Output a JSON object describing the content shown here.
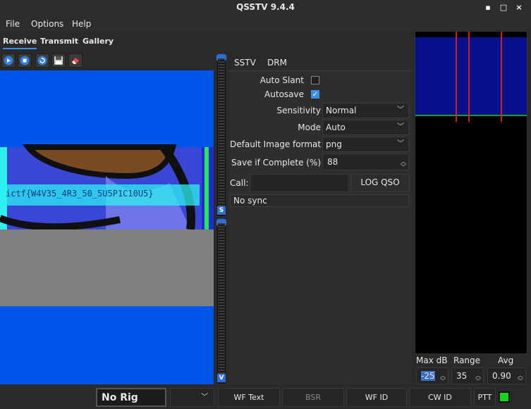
{
  "window": {
    "title": "QSSTV 9.4.4",
    "min": "▪",
    "max": "□",
    "close": "×"
  },
  "menu": {
    "file": "File",
    "options": "Options",
    "help": "Help"
  },
  "tabs": {
    "receive": "Receive",
    "transmit": "Transmit",
    "gallery": "Gallery"
  },
  "toolbar": {
    "icons": [
      "play-icon",
      "stop-icon",
      "refresh-icon",
      "save-icon",
      "erase-icon"
    ]
  },
  "image": {
    "overlay_text": "ictf{W4V35_4R3_50_5U5P1C10U5}"
  },
  "slider": {
    "mark": "S",
    "bottom_mark": "V"
  },
  "sstv_tabs": {
    "sstv": "SSTV",
    "drm": "DRM"
  },
  "settings": {
    "auto_slant_label": "Auto Slant",
    "auto_slant": false,
    "autosave_label": "Autosave",
    "autosave": true,
    "sensitivity_label": "Sensitivity",
    "sensitivity_value": "Normal",
    "mode_label": "Mode",
    "mode_value": "Auto",
    "format_label": "Default Image format",
    "format_value": "png",
    "save_complete_label": "Save if Complete (%)",
    "save_complete_value": "88",
    "call_label": "Call:",
    "call_value": "",
    "log_qso": "LOG QSO",
    "sync_status": "No sync"
  },
  "waterfall_controls": {
    "max_db_label": "Max dB",
    "max_db_value": "-25",
    "range_label": "Range",
    "range_value": "35",
    "avg_label": "Avg",
    "avg_value": "0.90"
  },
  "statusbar": {
    "rig": "No Rig",
    "wf_text": "WF Text",
    "bsr": "BSR",
    "wf_id": "WF ID",
    "cw_id": "CW ID",
    "ptt": "PTT"
  },
  "colors": {
    "accent": "#3d8ee6",
    "image_blue": "#0055ea",
    "ptt_led": "#19d419"
  }
}
